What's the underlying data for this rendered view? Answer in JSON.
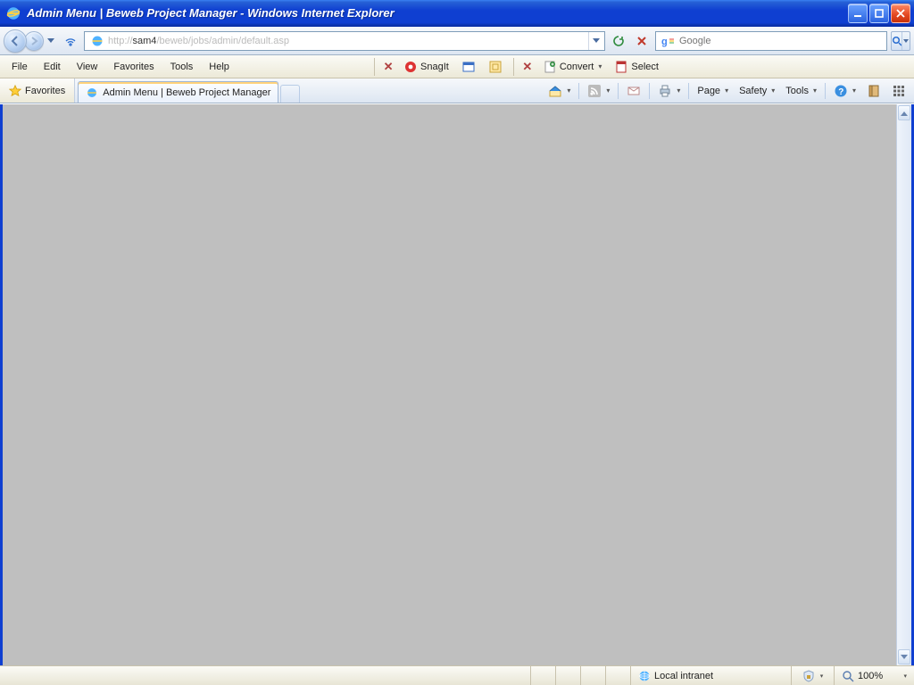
{
  "window": {
    "title": "Admin Menu | Beweb Project Manager - Windows Internet Explorer"
  },
  "address": {
    "prefix": "http://",
    "host": "sam4",
    "path": "/beweb/jobs/admin/default.asp"
  },
  "search": {
    "placeholder": "Google"
  },
  "menus": {
    "file": "File",
    "edit": "Edit",
    "view": "View",
    "favorites": "Favorites",
    "tools": "Tools",
    "help": "Help"
  },
  "toolbars": {
    "snagit": "SnagIt",
    "convert": "Convert",
    "select": "Select"
  },
  "favorites_button": "Favorites",
  "tab": {
    "title": "Admin Menu | Beweb Project Manager"
  },
  "cmdbar": {
    "page": "Page",
    "safety": "Safety",
    "tools": "Tools"
  },
  "status": {
    "zone": "Local intranet",
    "zoom": "100%"
  }
}
